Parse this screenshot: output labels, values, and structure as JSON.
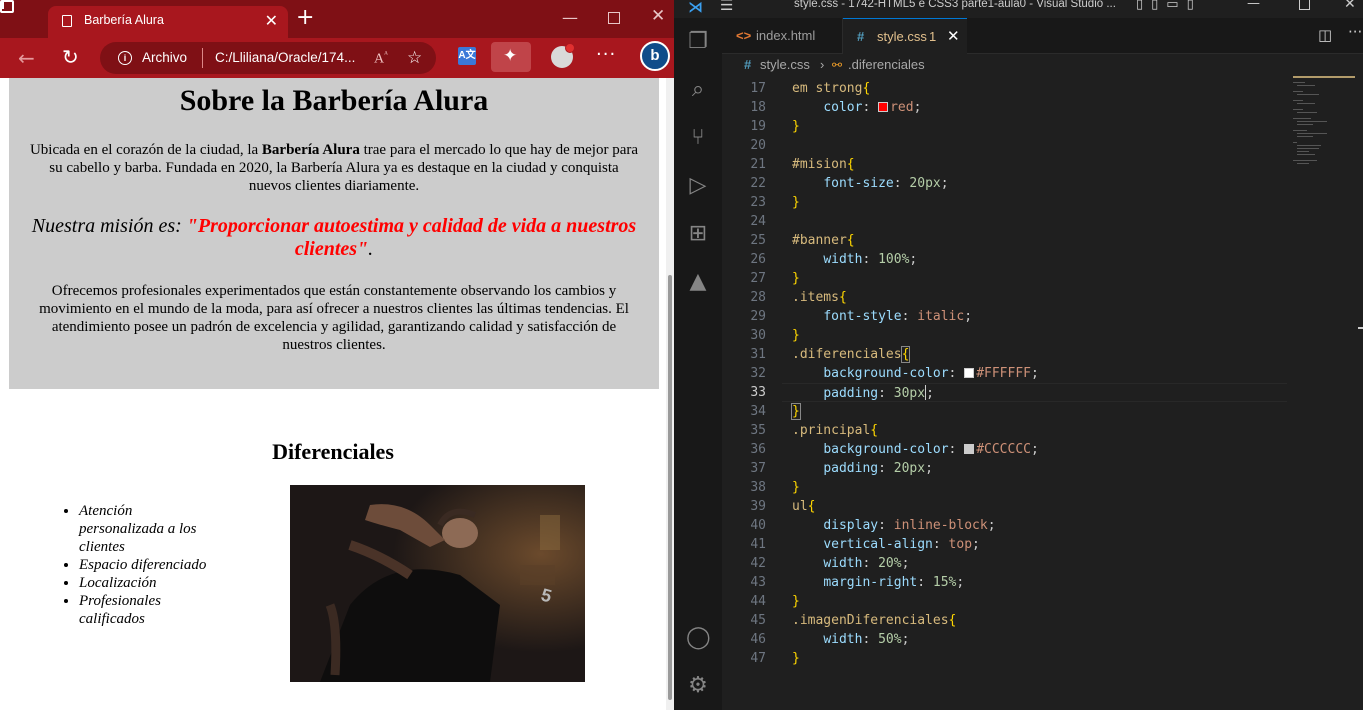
{
  "browser": {
    "tab_title": "Barbería Alura",
    "address_scheme": "Archivo",
    "address_url": "C:/Lliliana/Oracle/174...",
    "read_aloud": "A⁵",
    "accent_color": "#a8171e"
  },
  "page": {
    "heading": "Sobre la Barbería Alura",
    "para1_before": "Ubicada en el corazón de la ciudad, la ",
    "para1_bold": "Barbería Alura",
    "para1_after": " trae para el mercado lo que hay de mejor para su cabello y barba. Fundada en 2020, la Barbería Alura ya es destaque en la ciudad y conquista nuevos clientes diariamente.",
    "mision_label": "Nuestra misión es: ",
    "mision_quote": "\"Proporcionar autoestima y calidad de vida a nuestros clientes\"",
    "mision_end": ".",
    "para2": "Ofrecemos profesionales experimentados que están constantemente observando los cambios y movimiento en el mundo de la moda, para así ofrecer a nuestros clientes las últimas tendencias. El atendimiento posee un padrón de excelencia y agilidad, garantizando calidad y satisfacción de nuestros clientes.",
    "diferenciales_heading": "Diferenciales",
    "items": [
      "Atención personalizada a los clientes",
      "Espacio diferenciado",
      "Localización",
      "Profesionales calificados"
    ],
    "image_description": "barber shaving a client"
  },
  "vscode": {
    "window_title": "style.css - 1742-HTML5 e CSS3 parte1-aula0 - Visual Studio ...",
    "tabs": [
      {
        "label": "index.html",
        "icon": "html-icon"
      },
      {
        "label": "style.css",
        "icon": "css-icon",
        "modified_count": "1"
      }
    ],
    "breadcrumb_file": "style.css",
    "breadcrumb_symbol": ".diferenciales",
    "current_line": 33,
    "line_numbers": [
      "17",
      "18",
      "19",
      "20",
      "21",
      "22",
      "23",
      "24",
      "25",
      "26",
      "27",
      "28",
      "29",
      "30",
      "31",
      "32",
      "33",
      "34",
      "35",
      "36",
      "37",
      "38",
      "39",
      "40",
      "41",
      "42",
      "43",
      "44",
      "45",
      "46",
      "47"
    ]
  }
}
